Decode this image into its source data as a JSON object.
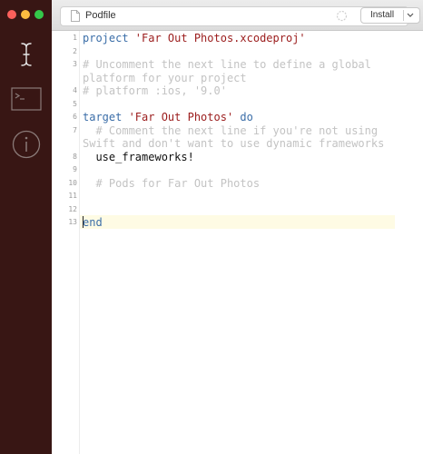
{
  "window": {
    "title": "Podfile",
    "install_label": "Install"
  },
  "sidebar": {
    "icons": [
      "text-cursor-icon",
      "terminal-icon",
      "info-icon"
    ]
  },
  "editor": {
    "line_numbers": [
      "1",
      "2",
      "3",
      "4",
      "5",
      "6",
      "7",
      "8",
      "9",
      "10",
      "11",
      "12",
      "13"
    ],
    "lines": [
      {
        "parts": [
          {
            "t": "project ",
            "c": "kw"
          },
          {
            "t": "'Far Out Photos.xcodeproj'",
            "c": "str"
          }
        ]
      },
      {
        "parts": []
      },
      {
        "parts": [
          {
            "t": "# Uncomment the next line to define a global",
            "c": "cmt"
          }
        ]
      },
      {
        "parts": [
          {
            "t": "platform for your project",
            "c": "cmt"
          }
        ]
      },
      {
        "parts": [
          {
            "t": "# platform :ios, '9.0'",
            "c": "cmt"
          }
        ]
      },
      {
        "parts": []
      },
      {
        "parts": [
          {
            "t": "target ",
            "c": "kw"
          },
          {
            "t": "'Far Out Photos'",
            "c": "str"
          },
          {
            "t": " do",
            "c": "kw"
          }
        ]
      },
      {
        "parts": [
          {
            "t": "  # Comment the next line if you're not using",
            "c": "cmt"
          }
        ]
      },
      {
        "parts": [
          {
            "t": "Swift and don't want to use dynamic frameworks",
            "c": "cmt"
          }
        ]
      },
      {
        "parts": [
          {
            "t": "  use_frameworks!",
            "c": "plain"
          }
        ]
      },
      {
        "parts": []
      },
      {
        "parts": [
          {
            "t": "  # Pods for Far Out Photos",
            "c": "cmt"
          }
        ]
      },
      {
        "parts": []
      },
      {
        "parts": []
      },
      {
        "parts": [
          {
            "t": "end",
            "c": "kw"
          }
        ]
      },
      {
        "parts": []
      }
    ]
  },
  "colors": {
    "sidebar": "#381614",
    "keyword": "#3b6ea8",
    "string": "#9b1c1c",
    "comment": "#c3c3c3",
    "active_line": "#fefbe4"
  }
}
